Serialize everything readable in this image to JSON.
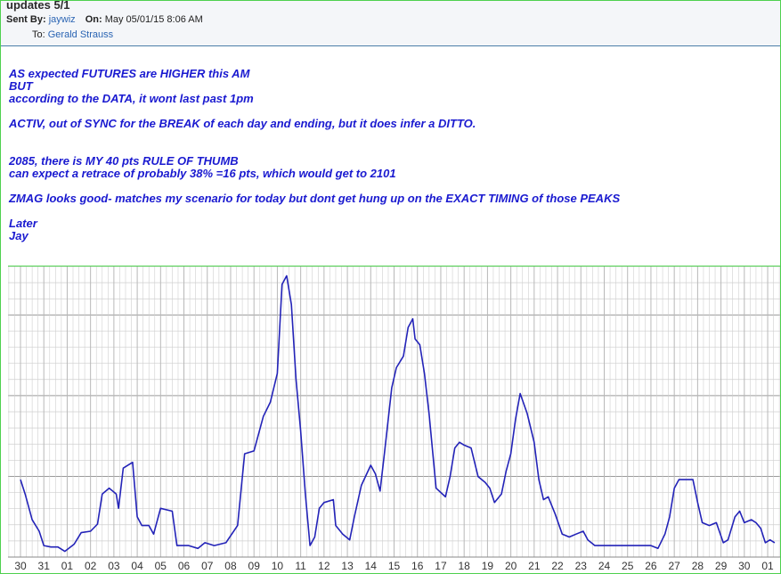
{
  "email": {
    "subject": "updates 5/1",
    "sent_by_label": "Sent By:",
    "sender": "jaywiz",
    "on_label": "On:",
    "date": "May 05/01/15 8:06 AM",
    "to_label": "To:",
    "recipient": "Gerald Strauss"
  },
  "body": {
    "lines": [
      "AS expected FUTURES are HIGHER this AM",
      "BUT",
      "according to the DATA, it wont last past 1pm",
      "",
      "ACTIV, out of SYNC for the BREAK of each day and ending, but it does infer a DITTO.",
      "",
      "",
      "2085, there is MY 40 pts RULE OF THUMB",
      "can expect a retrace of probably 38% =16 pts, which would get to 2101",
      "",
      "ZMAG looks good- matches my scenario for today but dont get hung up on the EXACT TIMING of those PEAKS",
      "",
      "Later",
      "Jay"
    ]
  },
  "colors": {
    "line": "#2323b8",
    "text": "#1a1ad0",
    "grid_minor": "#cfcfcf",
    "grid_major": "#9a9a9a",
    "frame": "#4fd14f"
  },
  "chart_data": {
    "type": "line",
    "title": "",
    "xlabel": "",
    "ylabel": "",
    "categories": [
      "30",
      "31",
      "01",
      "02",
      "03",
      "04",
      "05",
      "06",
      "07",
      "08",
      "09",
      "10",
      "11",
      "12",
      "13",
      "14",
      "15",
      "16",
      "17",
      "18",
      "19",
      "20",
      "21",
      "22",
      "23",
      "24",
      "25",
      "26",
      "27",
      "28",
      "29",
      "30",
      "01"
    ],
    "ylim": [
      0,
      100
    ],
    "grid": true,
    "series": [
      {
        "values": [
          [
            0.0,
            27
          ],
          [
            0.2,
            22
          ],
          [
            0.5,
            13
          ],
          [
            0.8,
            9
          ],
          [
            1.0,
            4
          ],
          [
            1.3,
            3.5
          ],
          [
            1.6,
            3.5
          ],
          [
            1.9,
            2
          ],
          [
            2.3,
            4.5
          ],
          [
            2.6,
            8.5
          ],
          [
            3.0,
            9
          ],
          [
            3.3,
            11.5
          ],
          [
            3.5,
            22
          ],
          [
            3.8,
            24
          ],
          [
            4.1,
            22
          ],
          [
            4.2,
            17
          ],
          [
            4.4,
            31
          ],
          [
            4.8,
            33
          ],
          [
            5.0,
            14
          ],
          [
            5.2,
            11
          ],
          [
            5.5,
            11
          ],
          [
            5.7,
            8
          ],
          [
            6.0,
            17
          ],
          [
            6.5,
            16
          ],
          [
            6.7,
            4
          ],
          [
            7.2,
            4
          ],
          [
            7.6,
            3
          ],
          [
            7.9,
            5
          ],
          [
            8.3,
            4
          ],
          [
            8.8,
            5
          ],
          [
            9.3,
            11
          ],
          [
            9.6,
            36
          ],
          [
            10.0,
            37
          ],
          [
            10.4,
            49
          ],
          [
            10.7,
            54
          ],
          [
            11.0,
            64
          ],
          [
            11.2,
            95
          ],
          [
            11.4,
            98
          ],
          [
            11.6,
            88
          ],
          [
            11.8,
            62
          ],
          [
            12.0,
            44
          ],
          [
            12.2,
            22
          ],
          [
            12.4,
            4
          ],
          [
            12.6,
            7
          ],
          [
            12.8,
            17
          ],
          [
            13.0,
            19
          ],
          [
            13.4,
            20
          ],
          [
            13.5,
            11
          ],
          [
            13.8,
            8
          ],
          [
            14.1,
            6
          ],
          [
            14.3,
            14
          ],
          [
            14.6,
            25
          ],
          [
            15.0,
            32
          ],
          [
            15.2,
            29
          ],
          [
            15.4,
            23
          ],
          [
            15.6,
            37
          ],
          [
            15.9,
            59
          ],
          [
            16.1,
            66
          ],
          [
            16.4,
            70
          ],
          [
            16.6,
            80
          ],
          [
            16.8,
            83
          ],
          [
            16.9,
            76
          ],
          [
            17.1,
            74
          ],
          [
            17.3,
            64
          ],
          [
            17.5,
            50
          ],
          [
            17.8,
            24
          ],
          [
            18.2,
            21
          ],
          [
            18.4,
            28
          ],
          [
            18.6,
            38
          ],
          [
            18.8,
            40
          ],
          [
            19.0,
            39
          ],
          [
            19.3,
            38
          ],
          [
            19.6,
            28
          ],
          [
            19.9,
            26
          ],
          [
            20.1,
            24
          ],
          [
            20.3,
            19
          ],
          [
            20.6,
            22
          ],
          [
            20.8,
            30
          ],
          [
            21.0,
            36
          ],
          [
            21.2,
            48
          ],
          [
            21.4,
            57
          ],
          [
            21.7,
            50
          ],
          [
            22.0,
            40
          ],
          [
            22.2,
            27
          ],
          [
            22.4,
            20
          ],
          [
            22.6,
            21
          ],
          [
            22.9,
            15
          ],
          [
            23.2,
            8
          ],
          [
            23.5,
            7
          ],
          [
            23.8,
            8
          ],
          [
            24.1,
            9
          ],
          [
            24.3,
            6
          ],
          [
            24.6,
            4
          ],
          [
            25.0,
            4
          ],
          [
            25.5,
            4
          ],
          [
            26.0,
            4
          ],
          [
            26.5,
            4
          ],
          [
            27.0,
            4
          ],
          [
            27.3,
            3
          ],
          [
            27.6,
            8
          ],
          [
            27.8,
            14
          ],
          [
            28.0,
            24
          ],
          [
            28.2,
            27
          ],
          [
            28.5,
            27
          ],
          [
            28.8,
            27
          ],
          [
            29.0,
            19
          ],
          [
            29.2,
            12
          ],
          [
            29.5,
            11
          ],
          [
            29.8,
            12
          ],
          [
            30.1,
            5
          ],
          [
            30.3,
            6
          ],
          [
            30.6,
            14
          ],
          [
            30.8,
            16
          ],
          [
            31.0,
            12
          ],
          [
            31.3,
            13
          ],
          [
            31.5,
            12
          ],
          [
            31.7,
            10
          ],
          [
            31.9,
            5
          ],
          [
            32.1,
            6
          ],
          [
            32.3,
            5
          ]
        ]
      }
    ]
  }
}
